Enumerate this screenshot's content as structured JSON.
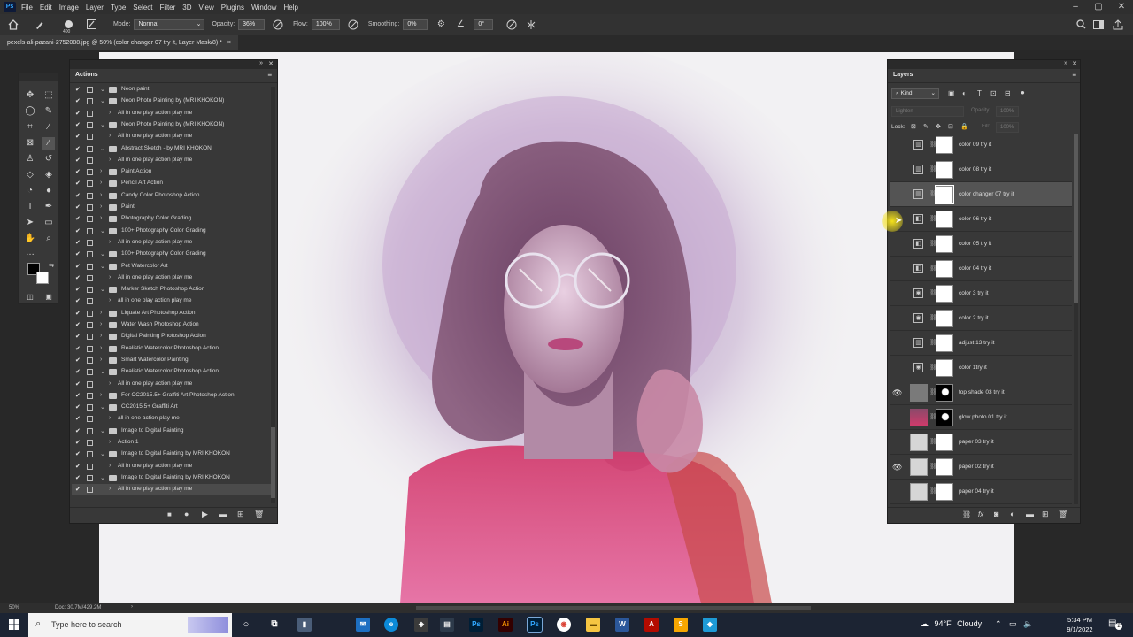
{
  "menubar": {
    "app_logo": "Ps",
    "items": [
      "File",
      "Edit",
      "Image",
      "Layer",
      "Type",
      "Select",
      "Filter",
      "3D",
      "View",
      "Plugins",
      "Window",
      "Help"
    ]
  },
  "optionsbar": {
    "brush_size": "400",
    "mode_label": "Mode:",
    "mode_value": "Normal",
    "opacity_label": "Opacity:",
    "opacity_value": "36%",
    "flow_label": "Flow:",
    "flow_value": "100%",
    "smoothing_label": "Smoothing:",
    "smoothing_value": "0%",
    "angle_value": "0°"
  },
  "document": {
    "tab_title": "pexels-ali-pazani-2752088.jpg @ 50% (color changer 07 try it, Layer Mask/8) *",
    "tab_close": "×"
  },
  "actions_panel": {
    "title": "Actions",
    "rows": [
      {
        "label": "Neon paint",
        "type": "set",
        "open": true
      },
      {
        "label": "Neon Photo Painting by (MRI KHOKON)",
        "type": "set",
        "open": true
      },
      {
        "label": "All in one play action play me",
        "type": "action"
      },
      {
        "label": "Neon Photo Painting by (MRI KHOKON)",
        "type": "set",
        "open": true
      },
      {
        "label": "All in one play action play me",
        "type": "action"
      },
      {
        "label": "Abstract Sketch - by MRI KHOKON",
        "type": "set",
        "open": true
      },
      {
        "label": "All in one play action play me",
        "type": "action"
      },
      {
        "label": "Paint Action",
        "type": "set",
        "open": false
      },
      {
        "label": "Pencil Art Action",
        "type": "set",
        "open": false
      },
      {
        "label": "Candy Color Photoshop Action",
        "type": "set",
        "open": false
      },
      {
        "label": "Paint",
        "type": "set",
        "open": false
      },
      {
        "label": "Photography Color Grading",
        "type": "set",
        "open": false
      },
      {
        "label": "100+ Photography Color Grading",
        "type": "set",
        "open": true
      },
      {
        "label": "All in one play action play me",
        "type": "action"
      },
      {
        "label": "100+ Photography Color Grading",
        "type": "set",
        "open": true
      },
      {
        "label": "Pet Watercolor Art",
        "type": "set",
        "open": true
      },
      {
        "label": "All in one play action play me",
        "type": "action"
      },
      {
        "label": "Marker Sketch Photoshop Action",
        "type": "set",
        "open": true
      },
      {
        "label": "all in one play action play me",
        "type": "action"
      },
      {
        "label": "Liquate Art Photoshop Action",
        "type": "set",
        "open": false
      },
      {
        "label": "Water Wash Photoshop Action",
        "type": "set",
        "open": false
      },
      {
        "label": "Digital Painting Photoshop Action",
        "type": "set",
        "open": false
      },
      {
        "label": "Realistic Watercolor Photoshop Action",
        "type": "set",
        "open": false
      },
      {
        "label": "Smart Watercolor Painting",
        "type": "set",
        "open": false
      },
      {
        "label": "Realistic Watercolor Photoshop Action",
        "type": "set",
        "open": true
      },
      {
        "label": "All in one play action play me",
        "type": "action"
      },
      {
        "label": "For CC2015.5+ Graffiti Art Photoshop Action",
        "type": "set",
        "open": false
      },
      {
        "label": "CC2015.5+ Graffiti Art",
        "type": "set",
        "open": true
      },
      {
        "label": "all in one action play me",
        "type": "action"
      },
      {
        "label": "Image to Digital Painting",
        "type": "set",
        "open": true
      },
      {
        "label": "Action 1",
        "type": "action"
      },
      {
        "label": "Image to Digital Painting by MRI KHOKON",
        "type": "set",
        "open": true
      },
      {
        "label": "All in one play action play me",
        "type": "action"
      },
      {
        "label": "Image to Digital Painting by MRI KHOKON",
        "type": "set",
        "open": true
      },
      {
        "label": "All in one play action play me",
        "type": "action",
        "selected": true
      }
    ]
  },
  "layers_panel": {
    "title": "Layers",
    "filter_kind": "Kind",
    "blend_mode": "Lighten",
    "opacity_label": "Opacity:",
    "opacity_value": "100%",
    "lock_label": "Lock:",
    "fill_label": "Fill:",
    "fill_value": "100%",
    "layers": [
      {
        "name": "color 09 try it",
        "visible": false,
        "kind": "levels"
      },
      {
        "name": "color 08 try it",
        "visible": false,
        "kind": "levels"
      },
      {
        "name": "color changer 07 try it",
        "visible": false,
        "kind": "levels",
        "selected": true
      },
      {
        "name": "color 06 try it",
        "visible": false,
        "kind": "bw"
      },
      {
        "name": "color 05 try it",
        "visible": false,
        "kind": "bw"
      },
      {
        "name": "color 04 try it",
        "visible": false,
        "kind": "bw"
      },
      {
        "name": "color 3 try it",
        "visible": false,
        "kind": "camera"
      },
      {
        "name": "color 2 try it",
        "visible": false,
        "kind": "camera"
      },
      {
        "name": "adjust 13 try it",
        "visible": false,
        "kind": "levels"
      },
      {
        "name": "color 1try it",
        "visible": false,
        "kind": "camera"
      },
      {
        "name": "top shade 03 try it",
        "visible": true,
        "kind": "gray-mask-black"
      },
      {
        "name": "glow photo 01 try it",
        "visible": false,
        "kind": "photo-mask-black"
      },
      {
        "name": "paper 03 try it",
        "visible": false,
        "kind": "paper"
      },
      {
        "name": "paper 02 try it",
        "visible": true,
        "kind": "paper"
      },
      {
        "name": "paper 04 try it",
        "visible": false,
        "kind": "paper"
      }
    ]
  },
  "statusbar": {
    "zoom": "50%",
    "doc_info": "Doc: 30.7M/429.2M"
  },
  "taskbar": {
    "search_placeholder": "Type here to search",
    "weather_temp": "94°F",
    "weather_text": "Cloudy",
    "time": "5:34 PM",
    "date": "9/1/2022",
    "notification_count": "2"
  },
  "colors": {
    "accent_blue": "#31a8ff",
    "cursor_highlight": "#f5e21b"
  }
}
